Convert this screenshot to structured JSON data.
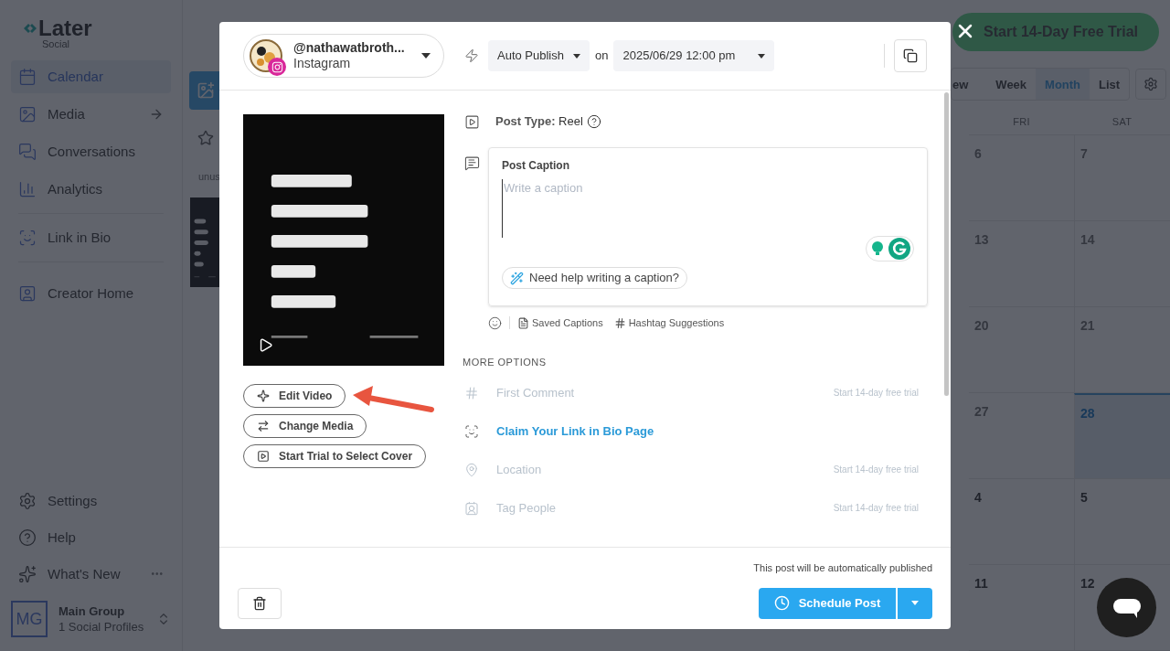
{
  "sidebar": {
    "logo": {
      "name": "Later",
      "sub": "Social"
    },
    "nav": [
      {
        "label": "Calendar",
        "selected": true
      },
      {
        "label": "Media",
        "selected": false
      },
      {
        "label": "Conversations",
        "selected": false
      },
      {
        "label": "Analytics",
        "selected": false
      },
      {
        "label": "Link in Bio",
        "selected": false
      },
      {
        "label": "Creator Home",
        "selected": false
      }
    ],
    "bottom": [
      {
        "label": "Settings"
      },
      {
        "label": "Help"
      },
      {
        "label": "What's New",
        "more": "•••"
      }
    ],
    "account": {
      "initials": "MG",
      "name": "Main Group",
      "profiles": "1 Social Profiles"
    }
  },
  "media_panel": {
    "tag": "unus"
  },
  "trial_banner": {
    "label": "Start 14-Day Free Trial"
  },
  "calendar": {
    "views": [
      {
        "label": "ew",
        "selected": false
      },
      {
        "label": "Week",
        "selected": false
      },
      {
        "label": "Month",
        "selected": true
      },
      {
        "label": "List",
        "selected": false
      }
    ],
    "days": [
      "FRI",
      "SAT"
    ],
    "weeks": [
      [
        {
          "day": "6",
          "past": true,
          "today": false
        },
        {
          "day": "7",
          "past": true,
          "today": false
        }
      ],
      [
        {
          "day": "13",
          "past": true,
          "today": false
        },
        {
          "day": "14",
          "past": true,
          "today": false
        }
      ],
      [
        {
          "day": "20",
          "past": true,
          "today": false
        },
        {
          "day": "21",
          "past": true,
          "today": false
        }
      ],
      [
        {
          "day": "27",
          "past": true,
          "today": false
        },
        {
          "day": "28",
          "past": false,
          "today": true
        }
      ],
      [
        {
          "day": "4",
          "past": false,
          "today": false
        },
        {
          "day": "5",
          "past": false,
          "today": false
        }
      ],
      [
        {
          "day": "11",
          "past": false,
          "today": false
        },
        {
          "day": "12",
          "past": false,
          "today": false
        }
      ]
    ]
  },
  "modal": {
    "account": {
      "handle": "@nathawatbroth...",
      "network": "Instagram"
    },
    "publish_mode": "Auto Publish",
    "on": "on",
    "datetime": "2025/06/29 12:00 pm",
    "media_buttons": [
      "Edit Video",
      "Change Media",
      "Start Trial to Select Cover"
    ],
    "post_type": {
      "label": "Post Type:",
      "value": "Reel"
    },
    "caption": {
      "label": "Post Caption",
      "placeholder": "Write a caption",
      "help": "Need help writing a caption?"
    },
    "caption_tools": [
      "Saved Captions",
      "Hashtag Suggestions"
    ],
    "more_options": {
      "heading": "MORE OPTIONS",
      "items": [
        {
          "label": "First Comment",
          "kind": "locked",
          "note": "Start 14-day free trial"
        },
        {
          "label": "Claim Your Link in Bio Page",
          "kind": "link"
        },
        {
          "label": "Location",
          "kind": "locked",
          "note": "Start 14-day free trial"
        },
        {
          "label": "Tag People",
          "kind": "locked",
          "note": "Start 14-day free trial"
        }
      ]
    },
    "footer_note": "This post will be automatically published",
    "schedule": "Schedule Post"
  }
}
